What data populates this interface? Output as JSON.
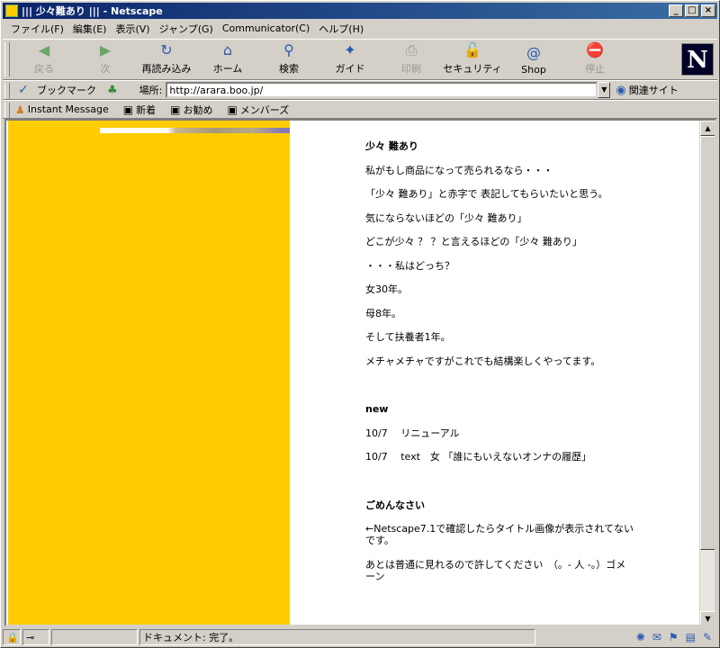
{
  "window": {
    "title": "||| 少々難あり |||  - Netscape",
    "controls": [
      "_",
      "□",
      "×"
    ]
  },
  "menu": [
    "ファイル(F)",
    "編集(E)",
    "表示(V)",
    "ジャンプ(G)",
    "Communicator(C)",
    "ヘルプ(H)"
  ],
  "toolbar": [
    {
      "label": "戻る",
      "icon": "back-icon",
      "glyph": "◀",
      "disabled": true
    },
    {
      "label": "次",
      "icon": "forward-icon",
      "glyph": "▶",
      "disabled": true
    },
    {
      "label": "再読み込み",
      "icon": "reload-icon",
      "glyph": "↻",
      "disabled": false
    },
    {
      "label": "ホーム",
      "icon": "home-icon",
      "glyph": "⌂",
      "disabled": false
    },
    {
      "label": "検索",
      "icon": "search-icon",
      "glyph": "⚲",
      "disabled": false
    },
    {
      "label": "ガイド",
      "icon": "guide-icon",
      "glyph": "✦",
      "disabled": false
    },
    {
      "label": "印刷",
      "icon": "print-icon",
      "glyph": "⎙",
      "disabled": true
    },
    {
      "label": "セキュリティ",
      "icon": "security-icon",
      "glyph": "🔓",
      "disabled": false
    },
    {
      "label": "Shop",
      "icon": "shop-icon",
      "glyph": "@",
      "disabled": false
    },
    {
      "label": "停止",
      "icon": "stop-icon",
      "glyph": "⛔",
      "disabled": true
    }
  ],
  "location": {
    "bookmarks_label": "ブックマーク",
    "label": "場所:",
    "url": "http://arara.boo.jp/",
    "related_label": "関連サイト"
  },
  "personal": [
    {
      "label": "Instant Message",
      "icon": "instant-message-icon",
      "glyph": "♟"
    },
    {
      "label": "新着",
      "icon": "bookmark-page-icon",
      "glyph": "▣"
    },
    {
      "label": "お勧め",
      "icon": "bookmark-page-icon",
      "glyph": "▣"
    },
    {
      "label": "メンバーズ",
      "icon": "bookmark-page-icon",
      "glyph": "▣"
    }
  ],
  "page": {
    "title": "少々 難あり",
    "lines": [
      "私がもし商品になって売られるなら・・・",
      "「少々 難あり」と赤字で 表記してもらいたいと思う。",
      "気にならないほどの「少々 難あり」",
      "どこが少々 ？ ？と言えるほどの「少々 難あり」",
      "・・・私はどっち？",
      "女30年。",
      "母8年。",
      "そして扶養者1年。",
      "メチャメチャですがこれでも結構楽しくやってます。"
    ],
    "new_heading": "new",
    "news": [
      "10/7　 リニューアル",
      "10/7　 text　女 「誰にもいえないオンナの履歴」"
    ],
    "apology_heading": "ごめんなさい",
    "apology_1": "←Netscape7.1で確認したらタイトル画像が表示されてないです。",
    "apology_2": "あとは普通に見れるので許してください　（。- 人 -。）ゴメーン"
  },
  "status": {
    "text": "ドキュメント: 完了。"
  },
  "colors": {
    "left_frame": "#ffcc00",
    "title_bar": "#0a246a"
  }
}
